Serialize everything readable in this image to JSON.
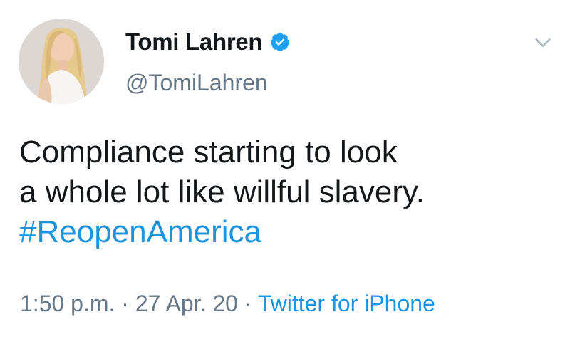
{
  "user": {
    "display_name": "Tomi Lahren",
    "handle": "@TomiLahren",
    "verified": true
  },
  "tweet": {
    "lines": [
      "Compliance starting to look",
      "a whole lot like willful slavery."
    ],
    "hashtag": "#ReopenAmerica"
  },
  "meta": {
    "time": "1:50 p.m.",
    "separator": "·",
    "date": "27 Apr. 20",
    "source": "Twitter for iPhone"
  },
  "icons": {
    "verified": "verified-badge-icon",
    "menu": "chevron-down-icon"
  },
  "colors": {
    "link": "#1b95e0",
    "secondary_text": "#657786",
    "primary_text": "#14171a"
  }
}
